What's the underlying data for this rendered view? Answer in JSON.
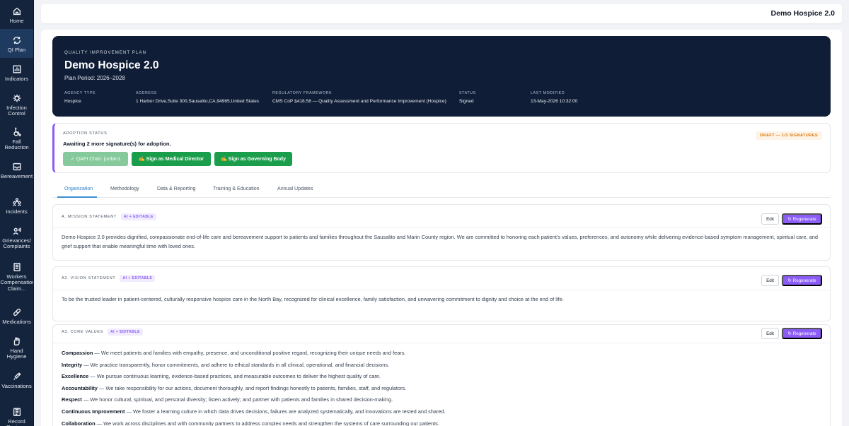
{
  "sidebar": {
    "items": [
      {
        "label": "Home",
        "icon": "home-icon"
      },
      {
        "label": "QI Plan",
        "icon": "refresh-icon"
      },
      {
        "label": "Indicators",
        "icon": "chart-icon"
      },
      {
        "label": "Infection Control",
        "icon": "virus-icon"
      },
      {
        "label": "Fall Reduction",
        "icon": "wheelchair-icon"
      },
      {
        "label": "Bereavement",
        "icon": "inbox-icon"
      },
      {
        "label": "Incidents",
        "icon": "people-icon"
      },
      {
        "label": "Grievances/ Complaints",
        "icon": "megaphone-icon"
      },
      {
        "label": "Workers Compensation Claim...",
        "icon": "document-icon"
      },
      {
        "label": "Medications",
        "icon": "pill-icon"
      },
      {
        "label": "Hand Hygiene",
        "icon": "hand-icon"
      },
      {
        "label": "Vaccinations",
        "icon": "syringe-icon"
      },
      {
        "label": "Record Reviews",
        "icon": "clipboard-icon"
      }
    ]
  },
  "topbar": {
    "title": "Demo Hospice 2.0"
  },
  "hero": {
    "kicker": "QUALITY IMPROVEMENT PLAN",
    "title": "Demo Hospice 2.0",
    "period": "Plan Period: 2026–2028",
    "meta": [
      {
        "label": "AGENCY TYPE",
        "value": "Hospice"
      },
      {
        "label": "ADDRESS",
        "value": "1 Harbor Drive,Suite 300,Sausalito,CA,94965,United States"
      },
      {
        "label": "REGULATORY FRAMEWORK",
        "value": "CMS CoP §418.58 — Quality Assessment and Performance Improvement (Hospice)"
      },
      {
        "label": "STATUS",
        "value": "Signed"
      },
      {
        "label": "LAST MODIFIED",
        "value": "13-May-2026 10:32:00"
      }
    ]
  },
  "adoption": {
    "label": "ADOPTION STATUS",
    "message": "Awaiting 2 more signature(s) for adoption.",
    "badge": "DRAFT — 1/3 SIGNATURES",
    "signed": "✓ QAPI Chair: jordan1",
    "sign_medical": "✍ Sign as Medical Director",
    "sign_governing": "✍ Sign as Governing Body"
  },
  "tabs": [
    "Organization",
    "Methodology",
    "Data & Reporting",
    "Training & Education",
    "Annual Updates"
  ],
  "common": {
    "ai_tag": "AI + EDITABLE",
    "edit": "Edit",
    "regenerate": "Regenerate"
  },
  "mission": {
    "label": "A. MISSION STATEMENT",
    "text": "Demo Hospice 2.0 provides dignified, compassionate end-of-life care and bereavement support to patients and families throughout the Sausalito and Marin County region. We are committed to honoring each patient's values, preferences, and autonomy while delivering evidence-based symptom management, spiritual care, and grief support that enable meaningful time with loved ones."
  },
  "vision": {
    "label": "A2. VISION STATEMENT",
    "text": "To be the trusted leader in patient-centered, culturally responsive hospice care in the North Bay, recognized for clinical excellence, family satisfaction, and unwavering commitment to dignity and choice at the end of life."
  },
  "core_values": {
    "label": "A3. CORE VALUES",
    "items": [
      {
        "term": "Compassion",
        "text": " — We meet patients and families with empathy, presence, and unconditional positive regard, recognizing their unique needs and fears."
      },
      {
        "term": "Integrity",
        "text": " — We practice transparently, honor commitments, and adhere to ethical standards in all clinical, operational, and financial decisions."
      },
      {
        "term": "Excellence",
        "text": " — We pursue continuous learning, evidence-based practices, and measurable outcomes to deliver the highest quality of care."
      },
      {
        "term": "Accountability",
        "text": " — We take responsibility for our actions, document thoroughly, and report findings honestly to patients, families, staff, and regulators."
      },
      {
        "term": "Respect",
        "text": " — We honor cultural, spiritual, and personal diversity; listen actively; and partner with patients and families in shared decision-making."
      },
      {
        "term": "Continuous Improvement",
        "text": " — We foster a learning culture in which data drives decisions, failures are analyzed systematically, and innovations are tested and shared."
      },
      {
        "term": "Collaboration",
        "text": " — We work across disciplines and with community partners to address complex needs and strengthen the systems of care surrounding our patients."
      }
    ]
  }
}
